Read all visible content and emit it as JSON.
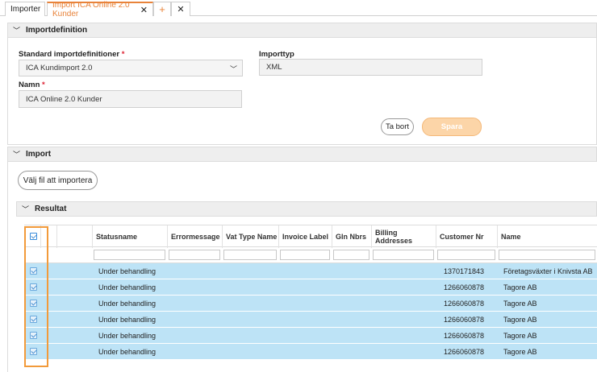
{
  "tabs": [
    {
      "label": "Importer"
    },
    {
      "label": "Import ICA Online 2.0 Kunder",
      "close": "✕"
    },
    {
      "label": "+"
    },
    {
      "label": "✕"
    }
  ],
  "importdefinition": {
    "title": "Importdefinition",
    "standard_label": "Standard importdefinitioner",
    "standard_value": "ICA Kundimport 2.0",
    "importtyp_label": "Importtyp",
    "importtyp_value": "XML",
    "namn_label": "Namn",
    "namn_value": "ICA Online 2.0 Kunder",
    "required_mark": "*",
    "delete_label": "Ta bort",
    "save_label": "Spara"
  },
  "import": {
    "title": "Import",
    "choose_file_label": "Välj fil att importera"
  },
  "resultat": {
    "title": "Resultat",
    "columns": [
      "Statusname",
      "Errormessage",
      "Vat Type Name",
      "Invoice Label",
      "Gln Nbrs",
      "Billing Addresses",
      "Customer Nr",
      "Name"
    ],
    "rows": [
      {
        "status": "Under behandling",
        "customer_nr": "1370171843",
        "name": "Företagsväxter i Knivsta AB"
      },
      {
        "status": "Under behandling",
        "customer_nr": "1266060878",
        "name": "Tagore AB"
      },
      {
        "status": "Under behandling",
        "customer_nr": "1266060878",
        "name": "Tagore AB"
      },
      {
        "status": "Under behandling",
        "customer_nr": "1266060878",
        "name": "Tagore AB"
      },
      {
        "status": "Under behandling",
        "customer_nr": "1266060878",
        "name": "Tagore AB"
      },
      {
        "status": "Under behandling",
        "customer_nr": "1266060878",
        "name": "Tagore AB"
      }
    ]
  },
  "colors": {
    "accent": "#e8833a",
    "row_selected": "#bde3f6",
    "highlight_box": "#f29a3a"
  }
}
